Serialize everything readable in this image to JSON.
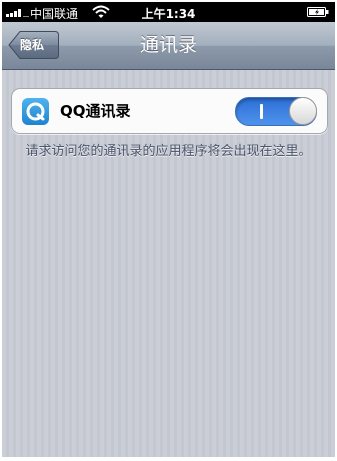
{
  "status_bar": {
    "carrier": "中国联通",
    "time": "上午1:34"
  },
  "nav": {
    "back_label": "隐私",
    "title": "通讯录"
  },
  "settings": {
    "row_label": "QQ通讯录",
    "toggle_on": true,
    "footnote": "请求访问您的通讯录的应用程序将会出现在这里。"
  },
  "icons": {
    "signal": "signal-bars-icon",
    "wifi": "wifi-icon",
    "battery": "battery-icon",
    "app": "qq-contacts-app-icon"
  },
  "colors": {
    "nav_bar": "#8d9aab",
    "switch_on": "#2c6fd6",
    "footnote_text": "#4c566c"
  }
}
